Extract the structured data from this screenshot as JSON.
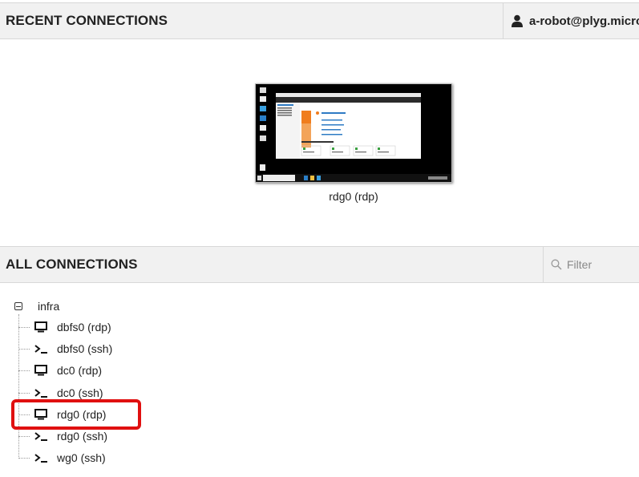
{
  "recent": {
    "title": "RECENT CONNECTIONS",
    "thumbnail_label": "rdg0 (rdp)"
  },
  "user": {
    "name": "a-robot@plyg.microk",
    "icon": "user-icon"
  },
  "all": {
    "title": "ALL CONNECTIONS",
    "filter_placeholder": "Filter"
  },
  "tree": {
    "group_label": "infra",
    "items": [
      {
        "label": "dbfs0 (rdp)",
        "icon": "desktop-icon"
      },
      {
        "label": "dbfs0 (ssh)",
        "icon": "terminal-icon"
      },
      {
        "label": "dc0 (rdp)",
        "icon": "desktop-icon"
      },
      {
        "label": "dc0 (ssh)",
        "icon": "terminal-icon"
      },
      {
        "label": "rdg0 (rdp)",
        "icon": "desktop-icon"
      },
      {
        "label": "rdg0 (ssh)",
        "icon": "terminal-icon"
      },
      {
        "label": "wg0 (ssh)",
        "icon": "terminal-icon"
      }
    ]
  },
  "colors": {
    "highlight": "#e01010",
    "header_bg": "#f1f1f1"
  }
}
